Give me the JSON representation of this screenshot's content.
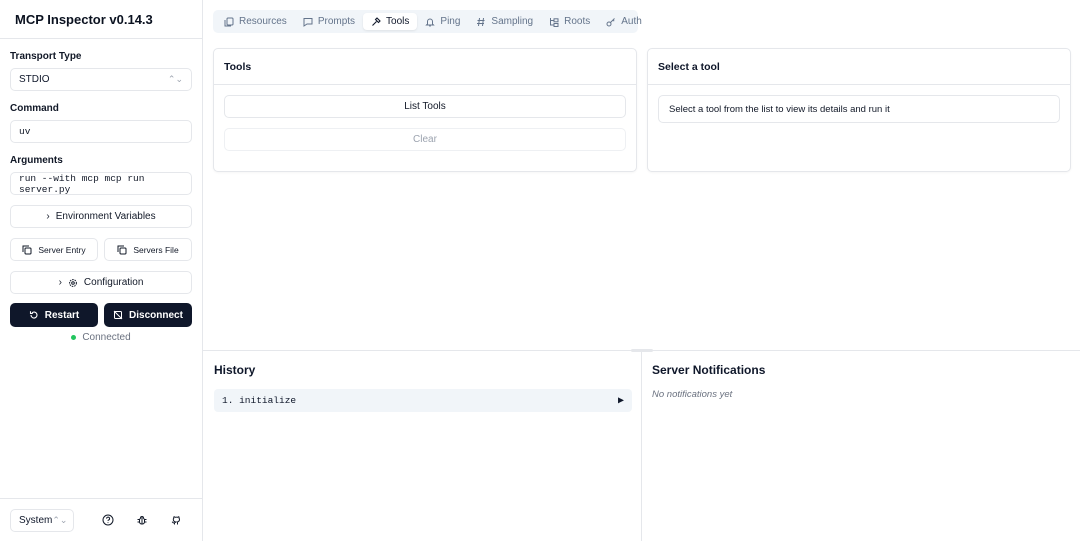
{
  "app": {
    "title": "MCP Inspector v0.14.3"
  },
  "sidebar": {
    "transport_label": "Transport Type",
    "transport_value": "STDIO",
    "command_label": "Command",
    "command_value": "uv",
    "arguments_label": "Arguments",
    "arguments_value": "run --with mcp mcp run server.py",
    "env_vars": "Environment Variables",
    "server_entry": "Server Entry",
    "servers_file": "Servers File",
    "configuration": "Configuration",
    "restart": "Restart",
    "disconnect": "Disconnect",
    "status": "Connected",
    "status_color": "#22c55e",
    "theme": "System"
  },
  "tabs": [
    {
      "label": "Resources",
      "icon": "resources-icon"
    },
    {
      "label": "Prompts",
      "icon": "message-icon"
    },
    {
      "label": "Tools",
      "icon": "hammer-icon",
      "active": true
    },
    {
      "label": "Ping",
      "icon": "bell-icon"
    },
    {
      "label": "Sampling",
      "icon": "hash-icon"
    },
    {
      "label": "Roots",
      "icon": "folder-tree-icon"
    },
    {
      "label": "Auth",
      "icon": "key-icon"
    }
  ],
  "tools_panel": {
    "title": "Tools",
    "list_button": "List Tools",
    "clear_button": "Clear"
  },
  "detail_panel": {
    "title": "Select a tool",
    "hint": "Select a tool from the list to view its details and run it"
  },
  "history": {
    "title": "History",
    "items": [
      "1. initialize"
    ]
  },
  "notifications": {
    "title": "Server Notifications",
    "empty": "No notifications yet"
  }
}
